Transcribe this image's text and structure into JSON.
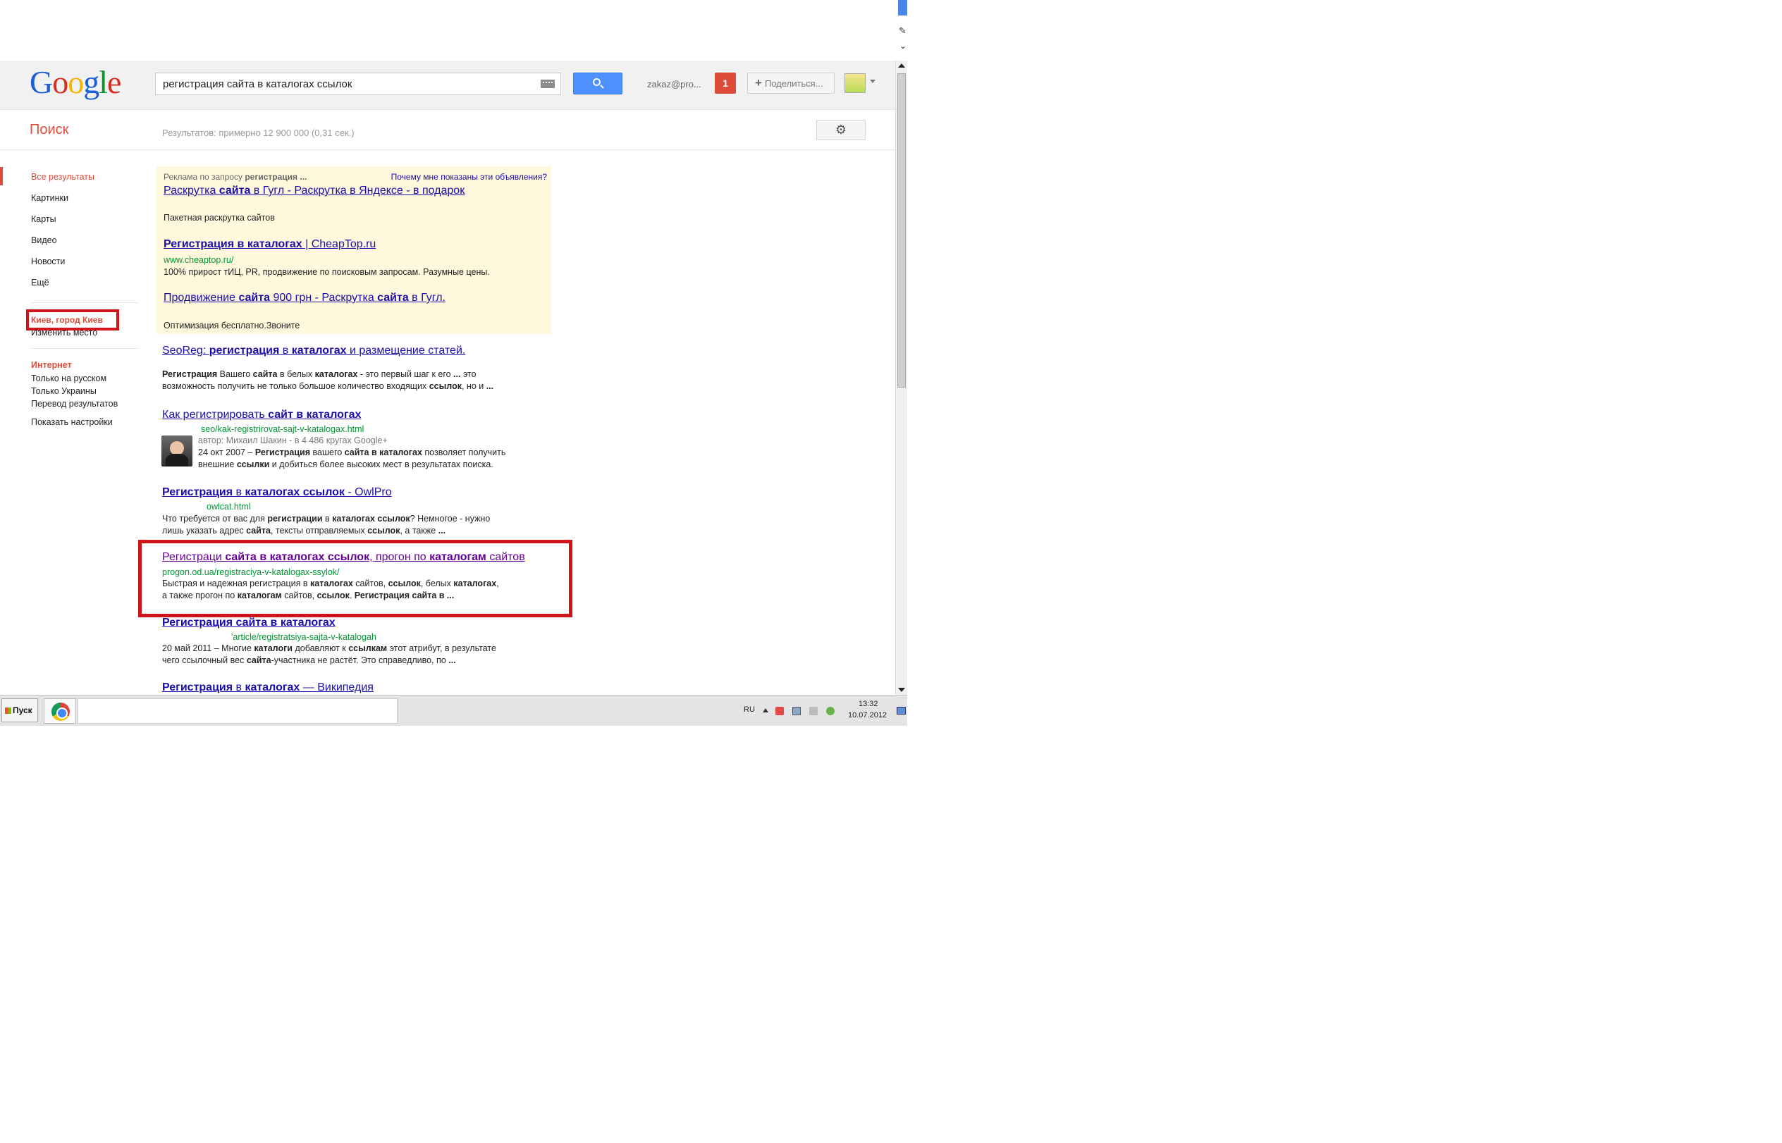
{
  "header": {
    "logo_letters": [
      "G",
      "o",
      "o",
      "g",
      "l",
      "e"
    ],
    "search_query": "регистрация сайта в каталогах ссылок",
    "account_email": "zakaz@pro...",
    "notification_count": "1",
    "share_label": "Поделиться...",
    "share_plus": "+"
  },
  "subheader": {
    "title": "Поиск",
    "result_stats": "Результатов: примерно 12 900 000 (0,31 сек.)",
    "settings_glyph": "⚙"
  },
  "leftnav": {
    "items": [
      {
        "label": "Все результаты",
        "active": true
      },
      {
        "label": "Картинки"
      },
      {
        "label": "Карты"
      },
      {
        "label": "Видео"
      },
      {
        "label": "Новости"
      },
      {
        "label": "Ещё"
      }
    ],
    "location": "Киев, город Киев",
    "change_location": "Изменить место",
    "internet_heading": "Интернет",
    "filters": [
      "Только на русском",
      "Только Украины",
      "Перевод результатов",
      "Показать настройки"
    ]
  },
  "ads": {
    "header_prefix": "Реклама по запросу ",
    "header_term": "регистрация ...",
    "why": "Почему мне показаны эти объявления?",
    "items": [
      {
        "title_parts": [
          "Раскрутка ",
          "сайта",
          " в Гугл - Раскрутка в Яндексе - в подарок"
        ],
        "snippet": "Пакетная раскрутка сайтов"
      },
      {
        "title_parts": [
          "Регистрация",
          " ",
          "в каталогах",
          " | CheapTop.ru"
        ],
        "url": "www.cheaptop.ru/",
        "snippet": "100% прирост тИЦ, PR, продвижение по поисковым запросам. Разумные цены."
      },
      {
        "title_parts": [
          "Продвижение ",
          "сайта",
          " 900 грн - Раскрутка ",
          "сайта",
          " в Гугл."
        ],
        "snippet": "Оптимизация бесплатно.Звоните"
      }
    ]
  },
  "results": [
    {
      "title_parts": [
        "SeoReg: ",
        "регистрация",
        " в ",
        "каталогах",
        " и размещение статей."
      ],
      "snippet_line1": [
        "Регистрация",
        " Вашего ",
        "сайта",
        " в белых ",
        "каталогах",
        " - это первый шаг к его ",
        "...",
        " это"
      ],
      "snippet_line2": [
        "возможность получить не только большое количество входящих ",
        "ссылок",
        ", но и ",
        "..."
      ]
    },
    {
      "title_parts": [
        "Как регистрировать ",
        "сайт в каталогах"
      ],
      "url": "seo/kak-registrirovat-sajt-v-katalogax.html",
      "author": "автор: Михаил Шакин - в 4 486 кругах Google+",
      "snippet_line1": [
        "24 окт 2007 – ",
        "Регистрация",
        " вашего ",
        "сайта в каталогах",
        " позволяет получить"
      ],
      "snippet_line2": [
        "внешние ",
        "ссылки",
        " и добиться более высоких мест в результатах поиска."
      ]
    },
    {
      "title_parts": [
        "Регистрация",
        " в ",
        "каталогах ссылок",
        " - OwlPro"
      ],
      "url": "owlcat.html",
      "snippet_line1": [
        "Что требуется от вас для ",
        "регистрации",
        " в ",
        "каталогах ссылок",
        "? Немногое - нужно"
      ],
      "snippet_line2": [
        "лишь указать адрес ",
        "сайта",
        ", тексты отправляемых ",
        "ссылок",
        ", а также ",
        "..."
      ]
    },
    {
      "title_parts": [
        "Регистраци ",
        "сайта в каталогах ссылок",
        ", прогон по ",
        "каталогам",
        " сайтов"
      ],
      "url": "progon.od.ua/registraciya-v-katalogax-ssylok/",
      "snippet_line1": [
        "Быстрая и надежная регистрация в ",
        "каталогах",
        " сайтов, ",
        "ссылок",
        ", белых ",
        "каталогах",
        ","
      ],
      "snippet_line2": [
        "а также прогон по ",
        "каталогам",
        " сайтов, ",
        "ссылок",
        ". ",
        "Регистрация сайта в ..."
      ]
    },
    {
      "title_parts": [
        "Регистрация сайта в каталогах"
      ],
      "url": "'article/registratsiya-sajta-v-katalogah",
      "snippet_line1": [
        "20 май 2011 – Многие ",
        "каталоги",
        " добавляют к ",
        "ссылкам",
        " этот атрибут, в результате"
      ],
      "snippet_line2": [
        "чего ссылочный вес ",
        "сайта",
        "-участника не растёт. Это справедливо, по ",
        "..."
      ]
    },
    {
      "title_parts": [
        "Регистрация",
        " в ",
        "каталогах",
        " — Википедия"
      ]
    }
  ],
  "taskbar": {
    "start_label": "Пуск",
    "language": "RU",
    "time": "13:32",
    "date": "10.07.2012"
  },
  "colors": {
    "accent_red": "#dd4b39",
    "link_blue": "#1a0dab",
    "link_visited": "#660099",
    "url_green": "#009933",
    "ad_background": "#fff8dd",
    "annotation_red": "#d0141c"
  }
}
